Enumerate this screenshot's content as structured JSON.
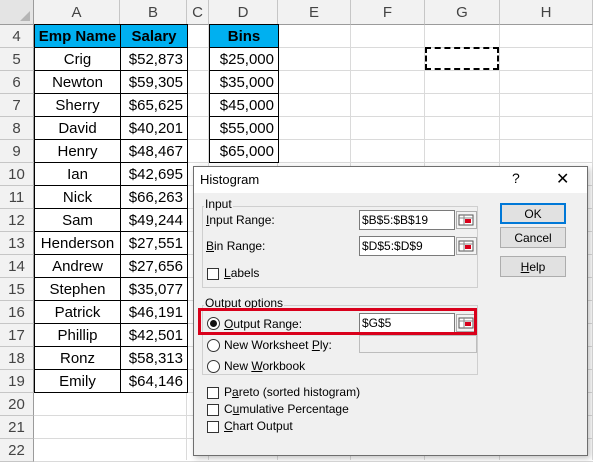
{
  "sheet": {
    "columns": [
      "A",
      "B",
      "C",
      "D",
      "E",
      "F",
      "G",
      "H"
    ],
    "rows": [
      "4",
      "5",
      "6",
      "7",
      "8",
      "9",
      "10",
      "11",
      "12",
      "13",
      "14",
      "15",
      "16",
      "17",
      "18",
      "19",
      "20",
      "21",
      "22"
    ],
    "headers": {
      "emp_name": "Emp Name",
      "salary": "Salary",
      "bins": "Bins"
    },
    "employees": [
      {
        "name": "Crig",
        "salary": "$52,873"
      },
      {
        "name": "Newton",
        "salary": "$59,305"
      },
      {
        "name": "Sherry",
        "salary": "$65,625"
      },
      {
        "name": "David",
        "salary": "$40,201"
      },
      {
        "name": "Henry",
        "salary": "$48,467"
      },
      {
        "name": "Ian",
        "salary": "$42,695"
      },
      {
        "name": "Nick",
        "salary": "$66,263"
      },
      {
        "name": "Sam",
        "salary": "$49,244"
      },
      {
        "name": "Henderson",
        "salary": "$27,551"
      },
      {
        "name": "Andrew",
        "salary": "$27,656"
      },
      {
        "name": "Stephen",
        "salary": "$35,077"
      },
      {
        "name": "Patrick",
        "salary": "$46,191"
      },
      {
        "name": "Phillip",
        "salary": "$42,501"
      },
      {
        "name": "Ronz",
        "salary": "$58,313"
      },
      {
        "name": "Emily",
        "salary": "$64,146"
      }
    ],
    "bins": [
      "$25,000",
      "$35,000",
      "$45,000",
      "$55,000",
      "$65,000"
    ]
  },
  "dialog": {
    "title": "Histogram",
    "help_glyph": "?",
    "close_glyph": "✕",
    "input_group": "Input",
    "input_range_label_u": "I",
    "input_range_label_rest": "nput Range:",
    "input_range_value": "$B$5:$B$19",
    "bin_range_label_u": "B",
    "bin_range_label_rest": "in Range:",
    "bin_range_value": "$D$5:$D$9",
    "labels_u": "L",
    "labels_rest": "abels",
    "output_group": "Output options",
    "output_range_u": "O",
    "output_range_rest": "utput Range:",
    "output_range_value": "$G$5",
    "new_ws_pre": "New Worksheet ",
    "new_ws_u": "P",
    "new_ws_post": "ly:",
    "new_wb_pre": "New ",
    "new_wb_u": "W",
    "new_wb_post": "orkbook",
    "pareto_u": "a",
    "pareto_pre": "P",
    "pareto_post": "reto (sorted histogram)",
    "cumulative_pre": "C",
    "cumulative_u": "u",
    "cumulative_post": "mulative Percentage",
    "chart_u": "C",
    "chart_rest": "hart Output",
    "ok": "OK",
    "cancel": "Cancel",
    "help_u": "H",
    "help_rest": "elp"
  }
}
